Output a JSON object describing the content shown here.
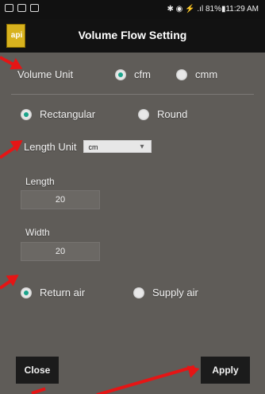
{
  "status_bar": {
    "right_text": "✱ ◉ ⚡ .ıl 81%▮11:29 AM"
  },
  "app": {
    "title": "Volume Flow Setting",
    "logo_text": " api"
  },
  "volume_unit": {
    "label": "Volume Unit",
    "options": [
      {
        "label": "cfm",
        "selected": true
      },
      {
        "label": "cmm",
        "selected": false
      }
    ]
  },
  "shape": {
    "options": [
      {
        "label": "Rectangular",
        "selected": true
      },
      {
        "label": "Round",
        "selected": false
      }
    ]
  },
  "length_unit": {
    "label": "Length Unit",
    "value": "cm",
    "caret": "▾"
  },
  "length": {
    "label": "Length",
    "value": "20"
  },
  "width": {
    "label": "Width",
    "value": "20"
  },
  "air_type": {
    "options": [
      {
        "label": "Return air",
        "selected": true
      },
      {
        "label": "Supply air",
        "selected": false
      }
    ]
  },
  "buttons": {
    "close": "Close",
    "apply": "Apply"
  },
  "annotations": {
    "arrow_color": "#e51515"
  }
}
